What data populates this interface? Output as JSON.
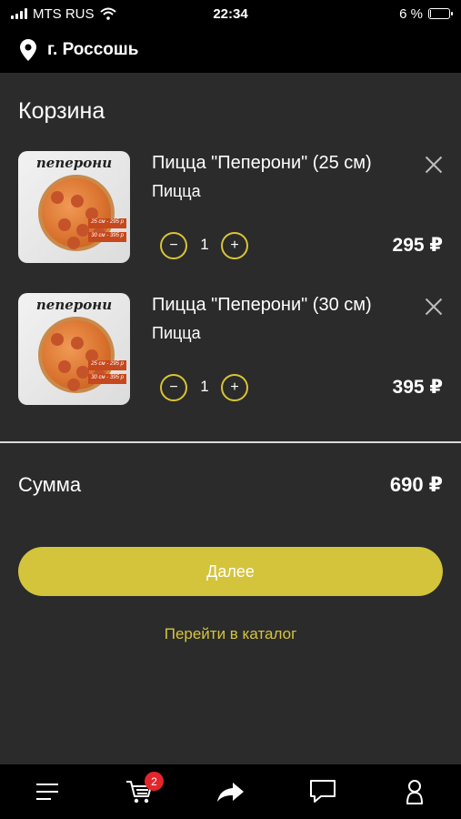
{
  "status_bar": {
    "carrier": "MTS RUS",
    "time": "22:34",
    "battery": "6 %",
    "battery_level": 0.06
  },
  "location": {
    "city": "г. Россошь",
    "icon": "location-pin-icon"
  },
  "page": {
    "title": "Корзина"
  },
  "cart": {
    "items": [
      {
        "thumb_title": "пеперони",
        "tag1": "25 см - 295 р",
        "tag2": "30 см - 395 р",
        "name": "Пицца \"Пеперони\" (25 см)",
        "category": "Пицца",
        "quantity": "1",
        "price": "295 ₽",
        "minus": "−",
        "plus": "+"
      },
      {
        "thumb_title": "пеперони",
        "tag1": "25 см - 295 р",
        "tag2": "30 см - 395 р",
        "name": "Пицца \"Пеперони\" (30 см)",
        "category": "Пицца",
        "quantity": "1",
        "price": "395 ₽",
        "minus": "−",
        "plus": "+"
      }
    ]
  },
  "summary": {
    "label": "Сумма",
    "value": "690 ₽"
  },
  "actions": {
    "next_label": "Далее",
    "catalog_link": "Перейти в каталог"
  },
  "tab_bar": {
    "cart_badge": "2",
    "icons": [
      "menu-icon",
      "cart-icon",
      "share-icon",
      "chat-icon",
      "profile-icon"
    ]
  },
  "colors": {
    "accent": "#d4c43c",
    "background": "#2b2b2b",
    "bar": "#000000",
    "badge": "#e3262b"
  }
}
